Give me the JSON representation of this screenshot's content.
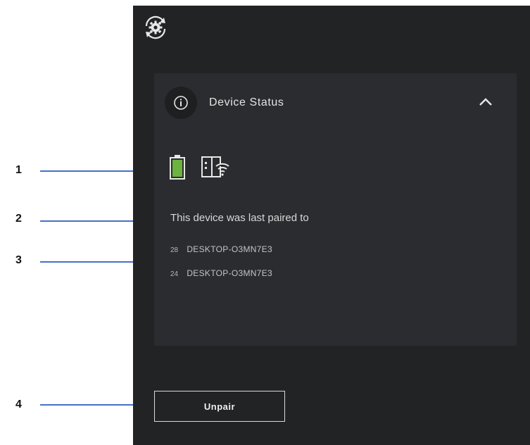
{
  "callouts": [
    "1",
    "2",
    "3",
    "4"
  ],
  "header": {
    "sync_icon": "sync-gear-icon"
  },
  "device_status": {
    "info_icon": "info-icon",
    "title": "Device Status",
    "collapse_icon": "chevron-up-icon",
    "battery_icon": "battery-icon",
    "battery_color": "#6db33f",
    "connection_icon": "device-wifi-icon",
    "paired_heading": "This device was last paired to",
    "paired_devices": [
      {
        "id": "28",
        "name": "DESKTOP-O3MN7E3"
      },
      {
        "id": "24",
        "name": "DESKTOP-O3MN7E3"
      }
    ]
  },
  "actions": {
    "unpair_label": "Unpair"
  },
  "colors": {
    "panel_bg": "#222325",
    "card_bg": "#2b2c2f",
    "callout_line": "#4472c4"
  }
}
